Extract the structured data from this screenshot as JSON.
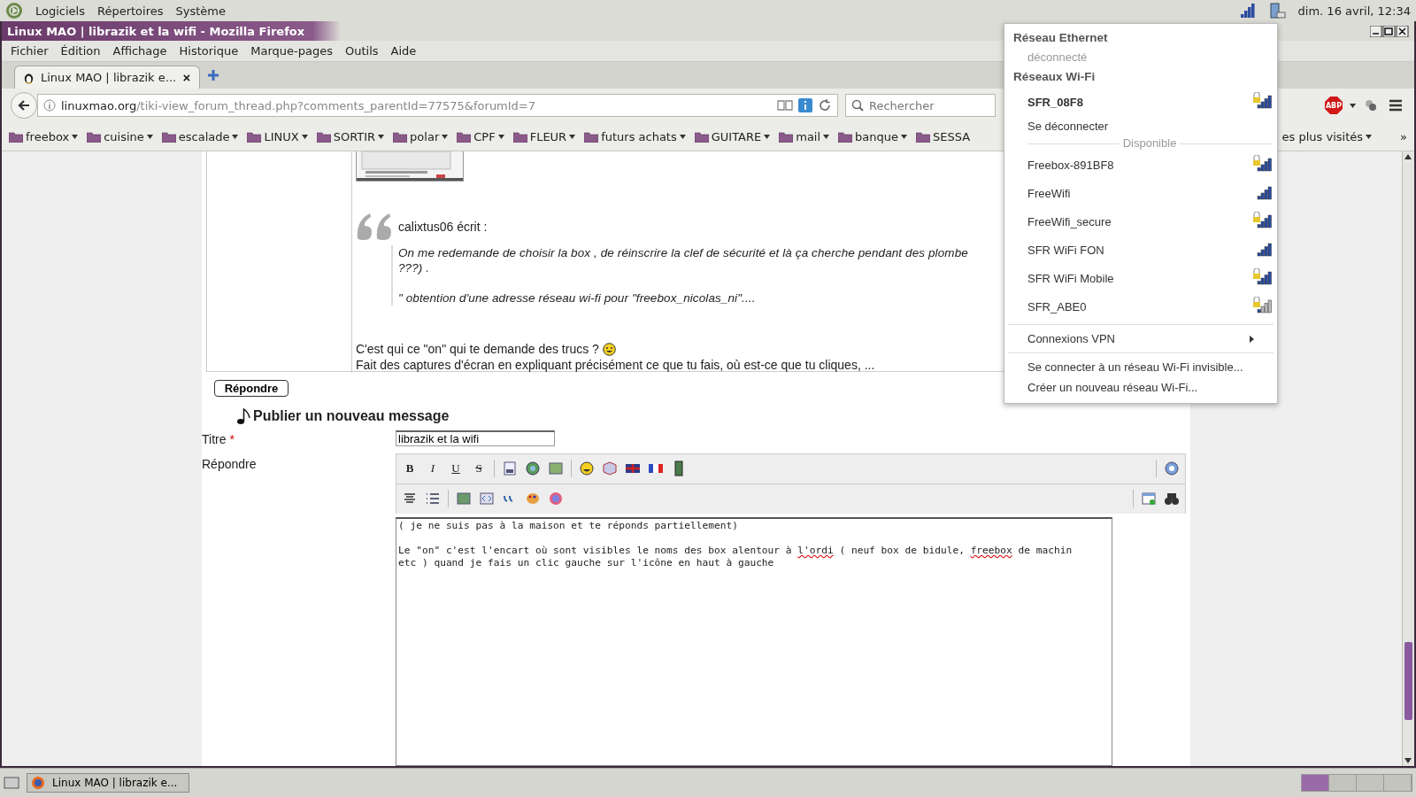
{
  "top_panel": {
    "menus": [
      "Logiciels",
      "Répertoires",
      "Système"
    ],
    "clock": "dim. 16 avril, 12:34"
  },
  "window": {
    "title": "Linux MAO | librazik et la wifi - Mozilla Firefox"
  },
  "menubar": [
    "Fichier",
    "Édition",
    "Affichage",
    "Historique",
    "Marque-pages",
    "Outils",
    "Aide"
  ],
  "tabs": [
    {
      "label": "Linux MAO | librazik e...",
      "selected": true
    }
  ],
  "url": {
    "host": "linuxmao.org",
    "path": "/tiki-view_forum_thread.php?comments_parentId=77575&forumId=7"
  },
  "search": {
    "placeholder": "Rechercher"
  },
  "adblock_label": "ABP",
  "bookmarks": [
    {
      "label": "freebox"
    },
    {
      "label": "cuisine"
    },
    {
      "label": "escalade"
    },
    {
      "label": "LINUX"
    },
    {
      "label": "SORTIR"
    },
    {
      "label": "polar"
    },
    {
      "label": "CPF"
    },
    {
      "label": "FLEUR"
    },
    {
      "label": "futurs achats"
    },
    {
      "label": "GUITARE"
    },
    {
      "label": "mail"
    },
    {
      "label": "banque"
    },
    {
      "label": "SESSA"
    }
  ],
  "bookmarks_more": "es plus visités",
  "bookmarks_overflow": "»",
  "post": {
    "quote_author": "calixtus06 écrit :",
    "quote_lines": [
      "On me redemande de choisir la box , de réinscrire la clef de sécurité et là ça cherche pendant des plombe",
      "???) .",
      "\" obtention d'une adresse réseau wi-fi pour \"freebox_nicolas_ni\"...."
    ],
    "body": [
      "C'est qui ce \"on\" qui te demande des trucs ?",
      "Fait des captures d'écran en expliquant précisément ce que tu fais, où est-ce que tu cliques, ..."
    ]
  },
  "reply_button": "Répondre",
  "new_message": {
    "heading": "Publier un nouveau message",
    "title_label": "Titre",
    "required_mark": "*",
    "title_value": "librazik et la wifi",
    "body_label": "Répondre",
    "format_buttons": [
      {
        "label": "B",
        "kind": "bold"
      },
      {
        "label": "I",
        "kind": "italic"
      },
      {
        "label": "U",
        "kind": "underline"
      },
      {
        "label": "S",
        "kind": "strike"
      }
    ],
    "paragraphs": [
      {
        "lines": [
          [
            {
              "text": "( je ne suis pas à la maison et te réponds partiellement)",
              "misspelled": false
            }
          ]
        ]
      },
      {
        "lines": [
          [
            {
              "text": "Le \"on\" c'est l'encart où sont visibles le noms des box alentour à ",
              "misspelled": false
            },
            {
              "text": "l'ordi",
              "misspelled": true
            },
            {
              "text": " ( neuf box de bidule, ",
              "misspelled": false
            },
            {
              "text": "freebox",
              "misspelled": true
            },
            {
              "text": " de machin",
              "misspelled": false
            }
          ],
          [
            {
              "text": "etc ) quand je fais un clic gauche sur l'icône en haut à gauche",
              "misspelled": false
            }
          ]
        ]
      }
    ]
  },
  "network_menu": {
    "ethernet_header": "Réseau Ethernet",
    "ethernet_status": "déconnecté",
    "wifi_header": "Réseaux Wi-Fi",
    "connected": {
      "name": "SFR_08F8",
      "secured": true,
      "weak": false
    },
    "disconnect": "Se déconnecter",
    "available_label": "Disponible",
    "networks": [
      {
        "name": "Freebox-891BF8",
        "secured": true,
        "weak": false
      },
      {
        "name": "FreeWifi",
        "secured": false,
        "weak": false
      },
      {
        "name": "FreeWifi_secure",
        "secured": true,
        "weak": false
      },
      {
        "name": "SFR WiFi FON",
        "secured": false,
        "weak": false
      },
      {
        "name": "SFR WiFi Mobile",
        "secured": true,
        "weak": false
      },
      {
        "name": "SFR_ABE0",
        "secured": true,
        "weak": true
      }
    ],
    "vpn": "Connexions VPN",
    "actions": [
      "Se connecter à un réseau Wi-Fi invisible...",
      "Créer un nouveau réseau Wi-Fi..."
    ]
  },
  "taskbar": {
    "tasks": [
      "Linux MAO | librazik e..."
    ],
    "workspaces": [
      {
        "selected": true
      },
      {
        "selected": false
      },
      {
        "selected": false
      },
      {
        "selected": false
      }
    ]
  }
}
